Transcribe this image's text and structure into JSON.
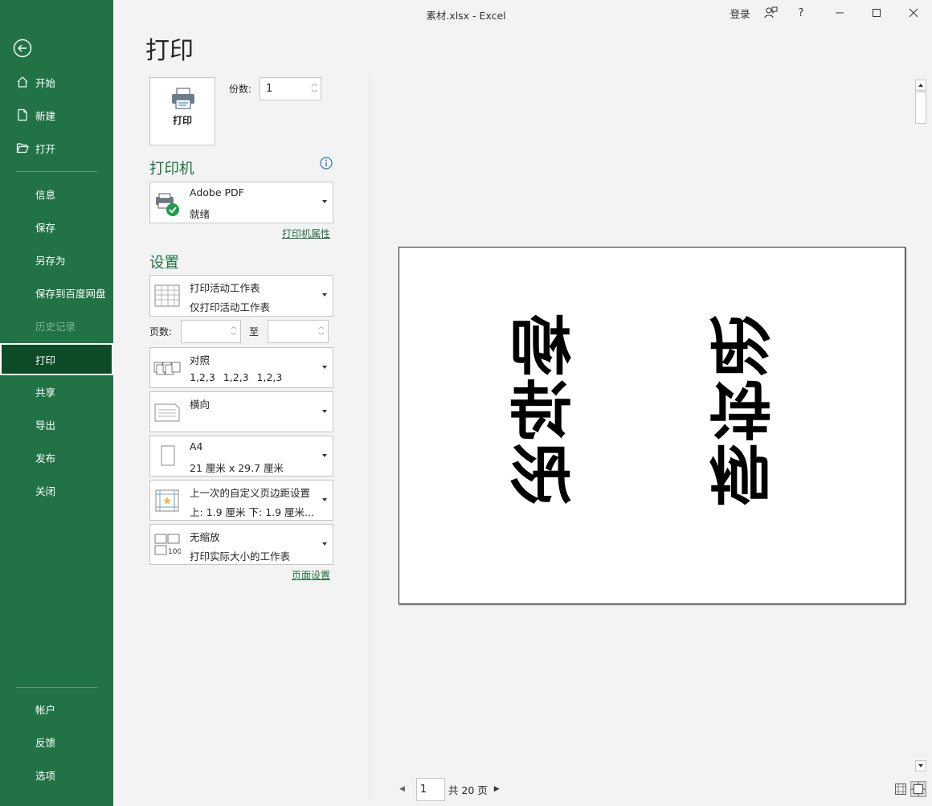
{
  "window": {
    "title": "素材.xlsx  -  Excel",
    "signin": "登录",
    "help": "?"
  },
  "sidebar": {
    "top_items": [
      {
        "label": "开始",
        "icon": "home-icon"
      },
      {
        "label": "新建",
        "icon": "new-file-icon"
      },
      {
        "label": "打开",
        "icon": "open-folder-icon"
      }
    ],
    "items": [
      "信息",
      "保存",
      "另存为",
      "保存到百度网盘",
      "历史记录",
      "打印",
      "共享",
      "导出",
      "发布",
      "关闭"
    ],
    "bottom_items": [
      "帐户",
      "反馈",
      "选项"
    ],
    "active": "打印",
    "disabled": "历史记录"
  },
  "main": {
    "title": "打印",
    "print_button": "打印",
    "copies_label": "份数:",
    "copies_value": "1",
    "printer_heading": "打印机",
    "printer": {
      "name": "Adobe PDF",
      "status": "就绪"
    },
    "printer_props_link": "打印机属性",
    "settings_heading": "设置",
    "what": {
      "line1": "打印活动工作表",
      "line2": "仅打印活动工作表"
    },
    "pages_label": "页数:",
    "pages_to": "至",
    "pages_from_value": "",
    "pages_to_value": "",
    "collate": {
      "line1": "对照",
      "line2": "1,2,3    1,2,3    1,2,3"
    },
    "orientation": {
      "line1": "横向"
    },
    "paper": {
      "line1": "A4",
      "line2": "21 厘米 x 29.7 厘米"
    },
    "margins": {
      "line1": "上一次的自定义页边距设置",
      "line2": "上: 1.9 厘米 下: 1.9 厘米..."
    },
    "scaling": {
      "line1": "无缩放",
      "line2": "打印实际大小的工作表"
    },
    "page_setup_link": "页面设置"
  },
  "preview": {
    "text_left": "柳诗彤",
    "text_right": "柳诗彤",
    "current_page": "1",
    "page_total": "共 20 页"
  }
}
